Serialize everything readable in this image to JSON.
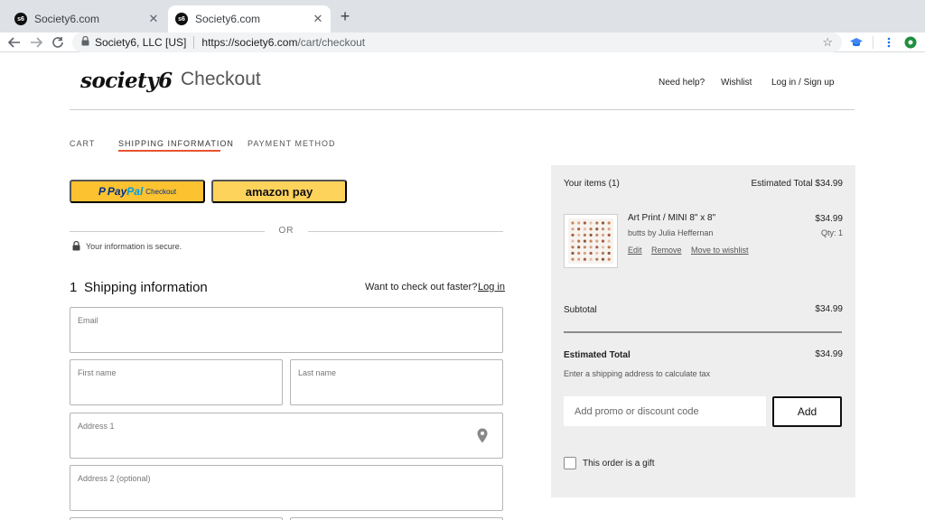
{
  "browser": {
    "tabs": [
      {
        "title": "Society6.com",
        "active": false
      },
      {
        "title": "Society6.com",
        "active": true
      }
    ],
    "favicon_text": "s6",
    "omnibox": {
      "site_name": "Society6, LLC [US]",
      "url_host": "https://society6.com",
      "url_path": "/cart/checkout"
    }
  },
  "header": {
    "logo": "society6",
    "page_title": "Checkout",
    "links": [
      "Need help?",
      "Wishlist",
      "Log in / Sign up"
    ]
  },
  "steps": {
    "cart": "CART",
    "shipping": "SHIPPING INFORMATION",
    "payment": "PAYMENT METHOD"
  },
  "express": {
    "paypal_prefix": "P",
    "paypal_word_a": "Pay",
    "paypal_word_b": "Pal",
    "paypal_suffix": "Checkout",
    "amazon_label": "amazon pay",
    "or_text": "OR",
    "secure_text": "Your information is secure."
  },
  "shipping": {
    "number": "1",
    "title": "Shipping information",
    "faster_text": "Want to check out faster?",
    "login_link": "Log in",
    "fields": {
      "email": "Email",
      "first_name": "First name",
      "last_name": "Last name",
      "address1": "Address 1",
      "address2": "Address 2 (optional)"
    }
  },
  "summary": {
    "items_label": "Your items (1)",
    "estimated_total_header": "Estimated Total $34.99",
    "item": {
      "name": "Art Print / MINI 8\" x 8\"",
      "artist": "butts by Julia Heffernan",
      "price": "$34.99",
      "qty": "Qty: 1",
      "actions": [
        "Edit",
        "Remove",
        "Move to wishlist"
      ]
    },
    "subtotal_label": "Subtotal",
    "subtotal_value": "$34.99",
    "estimated_total_label": "Estimated Total",
    "estimated_total_value": "$34.99",
    "tax_note": "Enter a shipping address to calculate tax",
    "promo_placeholder": "Add promo or discount code",
    "promo_button": "Add",
    "gift_label": "This order is a gift"
  },
  "colors": {
    "accent_underline": "#e8532f",
    "paypal_yellow": "#fcc230",
    "amazon_yellow": "#fdd35c",
    "summary_bg": "#eeeeee"
  },
  "icons": [
    "back-arrow-icon",
    "forward-arrow-icon",
    "reload-icon",
    "lock-icon",
    "star-icon",
    "map-pin-icon",
    "menu-dots-icon"
  ]
}
